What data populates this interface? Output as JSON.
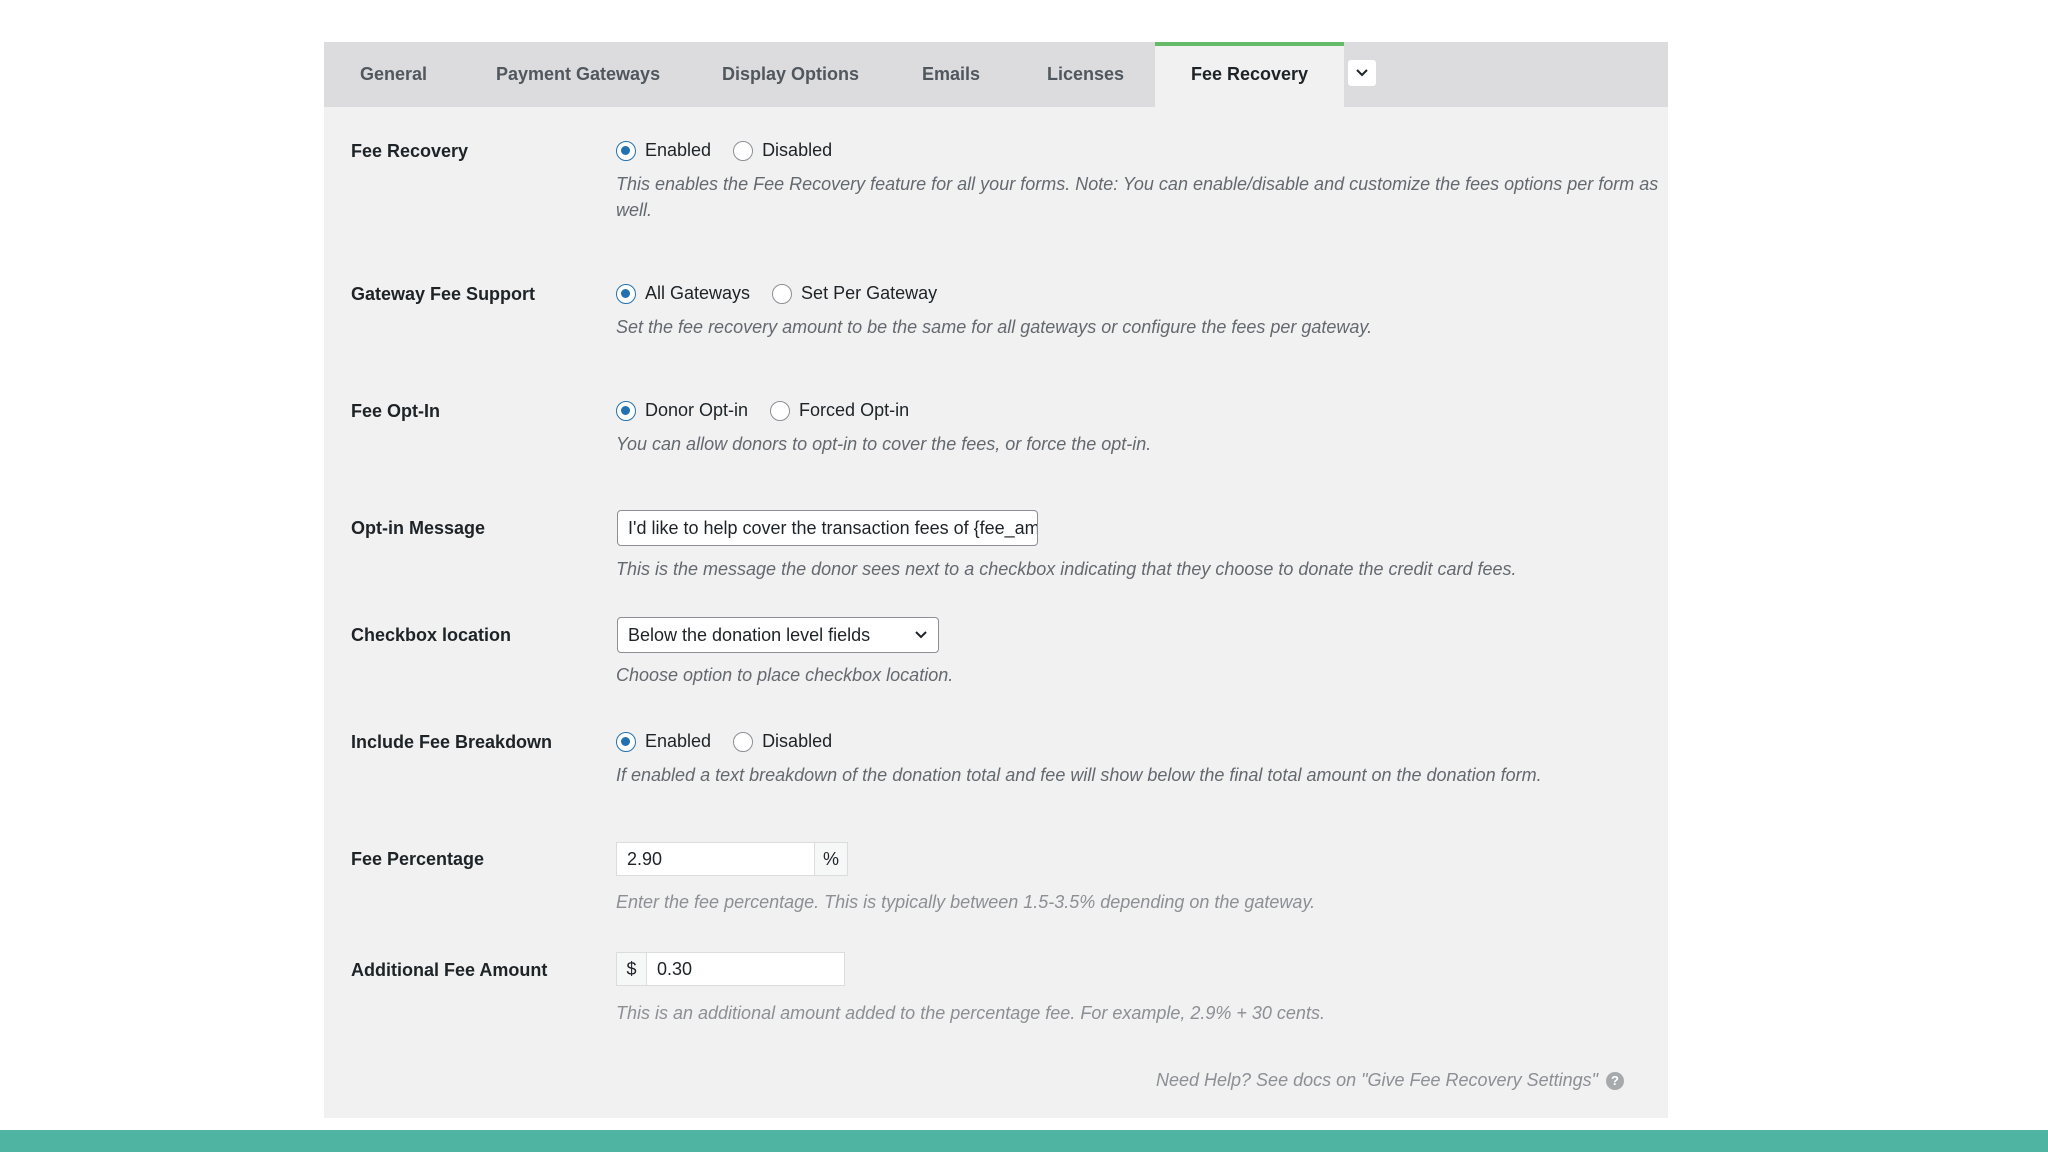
{
  "tabs": [
    {
      "label": "General"
    },
    {
      "label": "Payment Gateways"
    },
    {
      "label": "Display Options"
    },
    {
      "label": "Emails"
    },
    {
      "label": "Licenses"
    },
    {
      "label": "Fee Recovery",
      "active": true
    }
  ],
  "colors": {
    "active_tab_accent": "#66bb6a",
    "radio_checked": "#2271b1",
    "footer": "#4fb5a2"
  },
  "fee_recovery": {
    "label": "Fee Recovery",
    "options": [
      "Enabled",
      "Disabled"
    ],
    "selected": "Enabled",
    "description_line1": "This enables the Fee Recovery feature for all your forms. Note: You can enable/disable and customize the fees options per form as",
    "description_line2": "well."
  },
  "gateway_fee_support": {
    "label": "Gateway Fee Support",
    "options": [
      "All Gateways",
      "Set Per Gateway"
    ],
    "selected": "All Gateways",
    "description": "Set the fee recovery amount to be the same for all gateways or configure the fees per gateway."
  },
  "fee_opt_in": {
    "label": "Fee Opt-In",
    "options": [
      "Donor Opt-in",
      "Forced Opt-in"
    ],
    "selected": "Donor Opt-in",
    "description": "You can allow donors to opt-in to cover the fees, or force the opt-in."
  },
  "opt_in_message": {
    "label": "Opt-in Message",
    "value": "I'd like to help cover the transaction fees of {fee_am",
    "description": "This is the message the donor sees next to a checkbox indicating that they choose to donate the credit card fees."
  },
  "checkbox_location": {
    "label": "Checkbox location",
    "selected": "Below the donation level fields",
    "description": "Choose option to place checkbox location."
  },
  "include_fee_breakdown": {
    "label": "Include Fee Breakdown",
    "options": [
      "Enabled",
      "Disabled"
    ],
    "selected": "Enabled",
    "description": "If enabled a text breakdown of the donation total and fee will show below the final total amount on the donation form."
  },
  "fee_percentage": {
    "label": "Fee Percentage",
    "value": "2.90",
    "suffix": "%",
    "description": "Enter the fee percentage. This is typically between 1.5-3.5% depending on the gateway."
  },
  "additional_fee_amount": {
    "label": "Additional Fee Amount",
    "prefix": "$",
    "value": "0.30",
    "description": "This is an additional amount added to the percentage fee. For example, 2.9% + 30 cents."
  },
  "help": {
    "text": "Need Help? See docs on \"Give Fee Recovery Settings\"",
    "icon": "?"
  }
}
